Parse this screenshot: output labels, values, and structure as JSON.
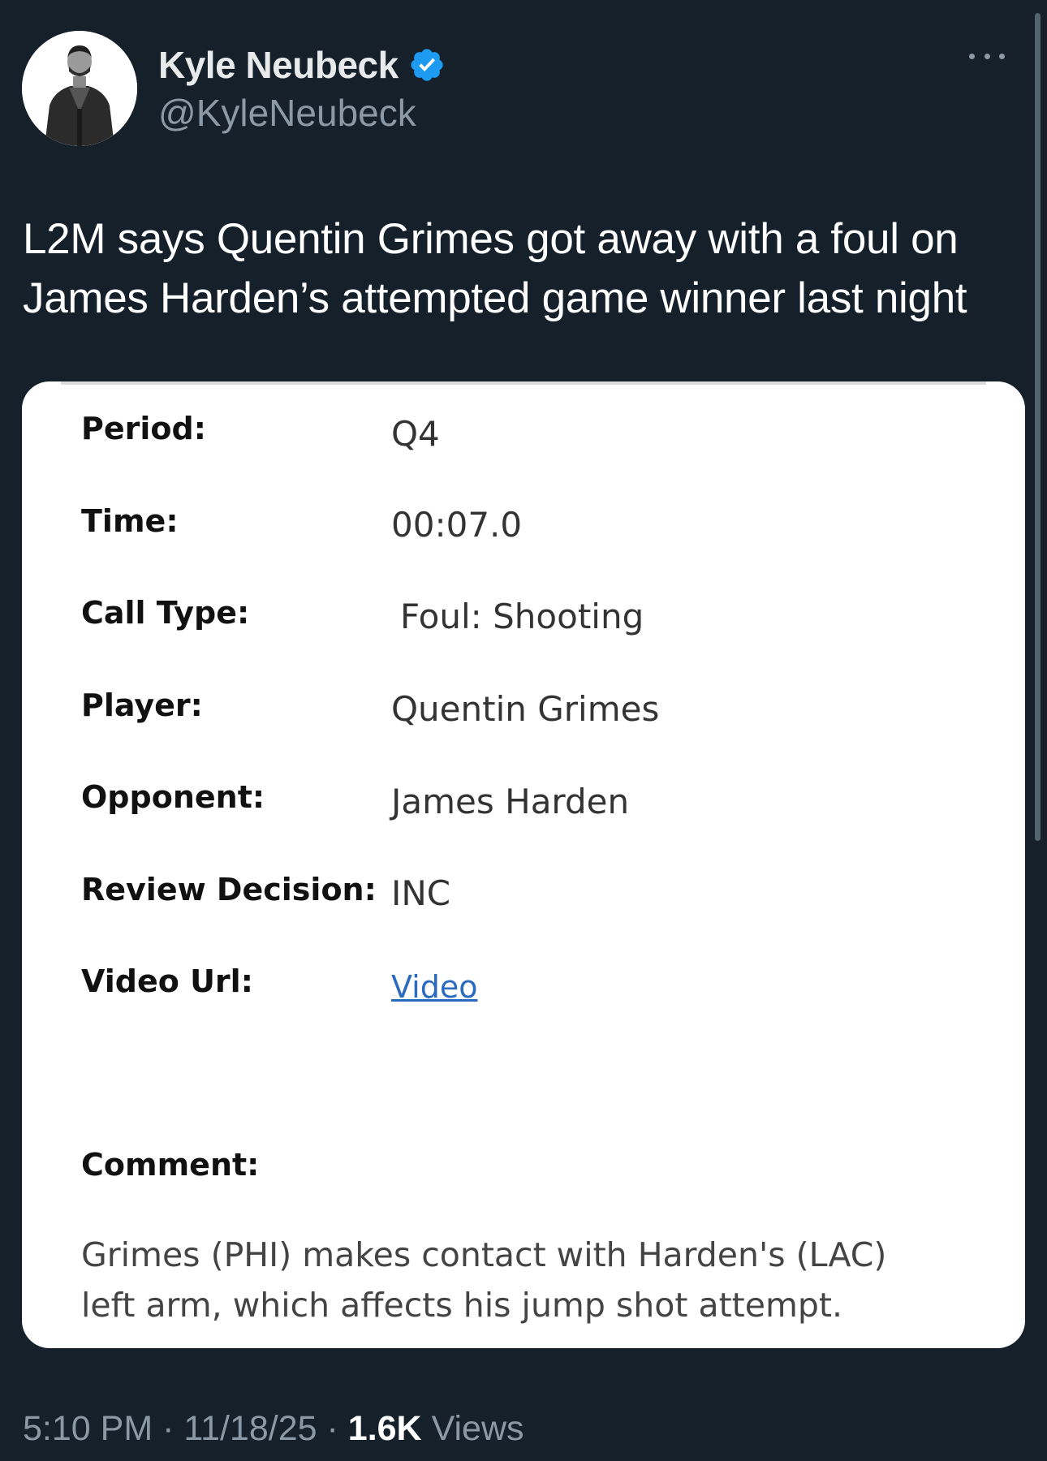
{
  "author": {
    "name": "Kyle Neubeck",
    "handle": "@KyleNeubeck",
    "verified": true,
    "verified_icon": "verified-badge-icon",
    "verified_color": "#1d9bf0"
  },
  "tweet": {
    "text_line1": "L2M says Quentin Grimes got away with a foul on",
    "text_line2": "James Harden’s attempted game winner last night"
  },
  "card": {
    "period_label": "Period:",
    "period_value": "Q4",
    "time_label": "Time:",
    "time_value": "00:07.0",
    "call_type_label": "Call Type:",
    "call_type_value": "Foul: Shooting",
    "player_label": "Player:",
    "player_value": "Quentin Grimes",
    "opponent_label": "Opponent:",
    "opponent_value": "James Harden",
    "review_label": "Review Decision:",
    "review_value": "INC",
    "video_label": "Video Url:",
    "video_value": "Video",
    "comment_label": "Comment:",
    "comment_line1": "Grimes (PHI) makes contact with Harden's (LAC)",
    "comment_line2": "left arm, which affects his jump shot attempt."
  },
  "meta": {
    "time": "5:10 PM",
    "sep1": " · ",
    "date": "11/18/25",
    "sep2": " · ",
    "views_count": "1.6K",
    "views_label": " Views"
  },
  "colors": {
    "background": "#15202b",
    "link": "#2a6bbf",
    "secondary_text": "#8b98a5"
  }
}
